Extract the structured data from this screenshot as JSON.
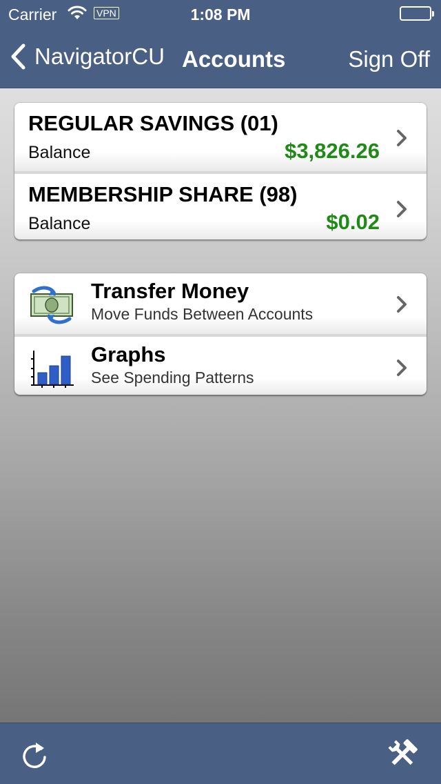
{
  "status_bar": {
    "carrier": "Carrier",
    "vpn": "VPN",
    "time": "1:08 PM"
  },
  "nav": {
    "back_label": "NavigatorCU",
    "title": "Accounts",
    "sign_off": "Sign Off"
  },
  "accounts": [
    {
      "name": "REGULAR SAVINGS (01)",
      "balance_label": "Balance",
      "balance": "$3,826.26"
    },
    {
      "name": "MEMBERSHIP SHARE (98)",
      "balance_label": "Balance",
      "balance": "$0.02"
    }
  ],
  "menu": [
    {
      "title": "Transfer Money",
      "subtitle": "Move Funds Between Accounts",
      "icon": "money-transfer-icon"
    },
    {
      "title": "Graphs",
      "subtitle": "See Spending Patterns",
      "icon": "bar-chart-icon"
    }
  ],
  "toolbar": {
    "left_icon": "refresh-icon",
    "right_icon": "tools-icon"
  },
  "colors": {
    "bar": "#4a5f84",
    "balance": "#1f8a16"
  }
}
